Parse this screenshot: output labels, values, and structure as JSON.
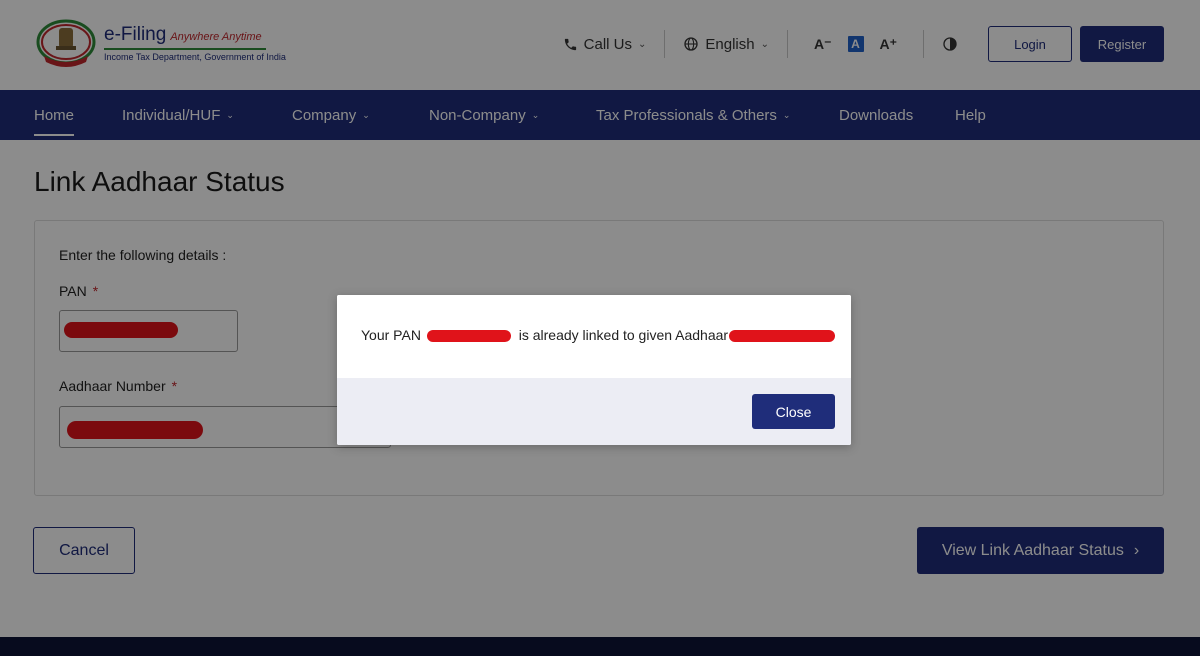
{
  "header": {
    "logo_title": "e-Filing",
    "logo_tagline": "Anywhere Anytime",
    "logo_subtitle": "Income Tax Department, Government of India",
    "call_us": "Call Us",
    "language": "English",
    "font_decrease": "A⁻",
    "font_default": "A",
    "font_increase": "A⁺",
    "login": "Login",
    "register": "Register"
  },
  "nav": {
    "items": [
      {
        "label": "Home",
        "has_menu": false
      },
      {
        "label": "Individual/HUF",
        "has_menu": true
      },
      {
        "label": "Company",
        "has_menu": true
      },
      {
        "label": "Non-Company",
        "has_menu": true
      },
      {
        "label": "Tax Professionals & Others",
        "has_menu": true
      },
      {
        "label": "Downloads",
        "has_menu": false
      },
      {
        "label": "Help",
        "has_menu": false
      }
    ]
  },
  "main": {
    "title": "Link Aadhaar Status",
    "instructions": "Enter the following details :",
    "pan_label": "PAN",
    "aadhaar_label": "Aadhaar Number",
    "required_mark": "*",
    "cancel": "Cancel",
    "view_status": "View Link Aadhaar Status"
  },
  "modal": {
    "msg_prefix": "Your PAN",
    "msg_middle": "is already linked to given Aadhaar",
    "close": "Close"
  },
  "colors": {
    "primary": "#1f2d7a",
    "redaction": "#e0131a",
    "required": "#c0272d"
  }
}
